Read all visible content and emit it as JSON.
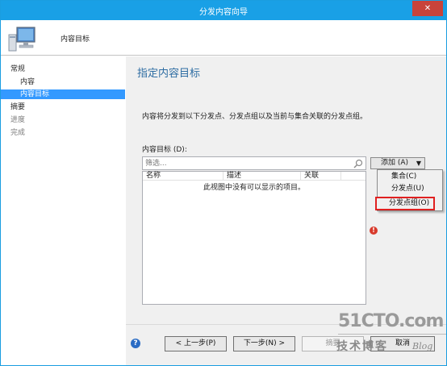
{
  "window": {
    "title": "分发内容向导",
    "close_label": "✕"
  },
  "header": {
    "title": "内容目标",
    "icon": "computer-monitor-icon"
  },
  "nav": {
    "items": [
      {
        "label": "常规",
        "level": 0,
        "state": "normal"
      },
      {
        "label": "内容",
        "level": 1,
        "state": "normal"
      },
      {
        "label": "内容目标",
        "level": 1,
        "state": "selected"
      },
      {
        "label": "摘要",
        "level": 0,
        "state": "normal"
      },
      {
        "label": "进度",
        "level": 0,
        "state": "disabled"
      },
      {
        "label": "完成",
        "level": 0,
        "state": "disabled"
      }
    ]
  },
  "main": {
    "heading": "指定内容目标",
    "description": "内容将分发到以下分发点、分发点组以及当前与集合关联的分发点组。",
    "targets_label": "内容目标 (D):",
    "filter_placeholder": "筛选...",
    "columns": [
      "名称",
      "描述",
      "关联"
    ],
    "empty_message": "此视图中没有可以显示的项目。",
    "add_button": "添加 (A)",
    "add_menu": [
      "集合(C)",
      "分发点(U)",
      "分发点组(O)"
    ],
    "highlighted_menu_item": "分发点组(O)",
    "accent_color": "#2d6ca2"
  },
  "footer": {
    "prev_label": "< 上一步(P)",
    "next_label": "下一步(N) >",
    "summary_label": "摘要",
    "cancel_label": "取消"
  },
  "watermark": {
    "big": "51CTO.com",
    "small": "技术博客",
    "blog": "Blog"
  }
}
